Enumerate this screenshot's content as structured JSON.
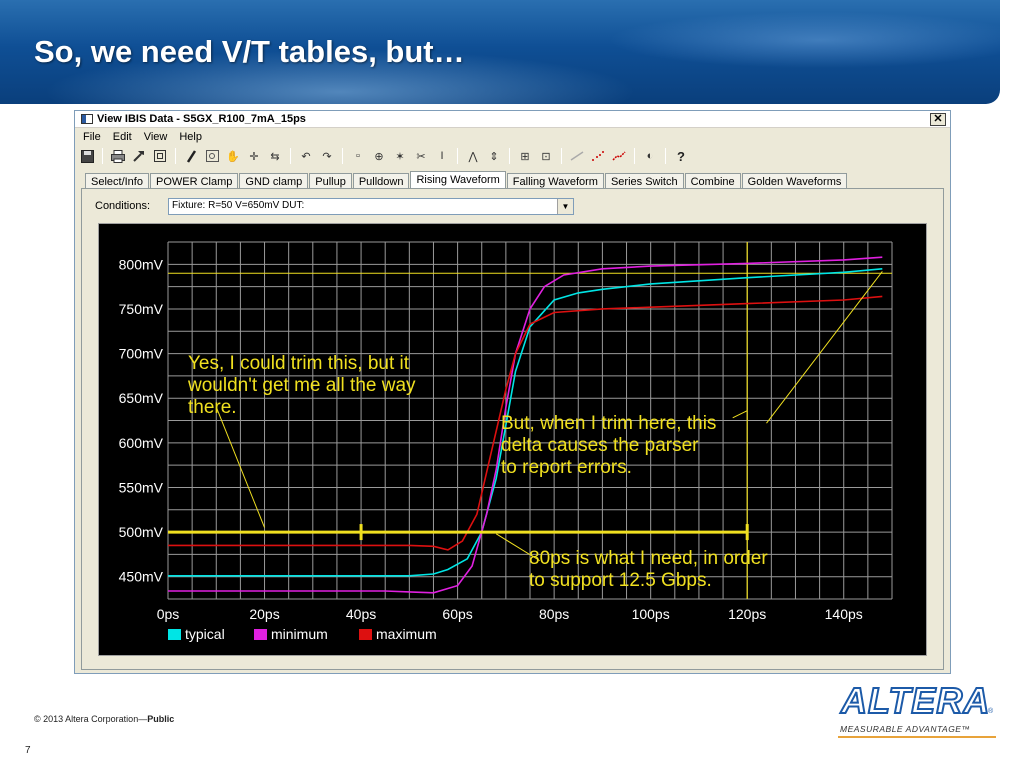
{
  "slide": {
    "title": "So, we need V/T tables, but…",
    "copyright_prefix": "© 2013 Altera Corporation—",
    "copyright_bold": "Public",
    "page_number": "7",
    "logo_text": "ALTERA",
    "logo_registered": "®",
    "logo_tagline": "MEASURABLE ADVANTAGE™"
  },
  "window": {
    "title": "View IBIS Data - S5GX_R100_7mA_15ps",
    "close_label": "✕",
    "menu": [
      "File",
      "Edit",
      "View",
      "Help"
    ],
    "toolbar_icons": [
      "save-icon",
      "print-icon",
      "hammer-icon",
      "frame-icon",
      "pencil-icon",
      "zoom-box-icon",
      "hand-icon",
      "crosshair-icon",
      "arrows-icon",
      "undo-icon",
      "redo-icon",
      "box-icon",
      "target-icon",
      "star-icon",
      "scissors-icon",
      "text-cursor-icon",
      "chevron-icon",
      "updown-icon",
      "fit-icon",
      "zoom-fit-icon",
      "line-icon",
      "dots-icon",
      "dash-icon",
      "disk-icon",
      "help-icon"
    ],
    "tabs": [
      {
        "label": "Select/Info",
        "active": false
      },
      {
        "label": "POWER Clamp",
        "active": false
      },
      {
        "label": "GND clamp",
        "active": false
      },
      {
        "label": "Pullup",
        "active": false
      },
      {
        "label": "Pulldown",
        "active": false
      },
      {
        "label": "Rising Waveform",
        "active": true
      },
      {
        "label": "Falling Waveform",
        "active": false
      },
      {
        "label": "Series Switch",
        "active": false
      },
      {
        "label": "Combine",
        "active": false
      },
      {
        "label": "Golden Waveforms",
        "active": false
      }
    ],
    "conditions_label": "Conditions:",
    "conditions_value": "Fixture: R=50 V=650mV  DUT:",
    "select_arrow": "▼"
  },
  "chart_data": {
    "type": "line",
    "x_unit": "ps",
    "y_unit": "mV",
    "xlim": [
      0,
      150
    ],
    "ylim": [
      425,
      825
    ],
    "x_ticks": [
      0,
      20,
      40,
      60,
      80,
      100,
      120,
      140
    ],
    "x_tick_labels": [
      "0ps",
      "20ps",
      "40ps",
      "60ps",
      "80ps",
      "100ps",
      "120ps",
      "140ps"
    ],
    "y_ticks": [
      450,
      500,
      550,
      600,
      650,
      700,
      750,
      800
    ],
    "y_tick_labels": [
      "450mV",
      "500mV",
      "550mV",
      "600mV",
      "650mV",
      "700mV",
      "750mV",
      "800mV"
    ],
    "grid": true,
    "legend_position": "bottom-left",
    "colors": {
      "typical": "#00e5e5",
      "minimum": "#e020e0",
      "maximum": "#dd1010",
      "annotation": "#f0e020"
    },
    "series": [
      {
        "name": "typical",
        "color": "#00e5e5",
        "x": [
          0,
          50,
          55,
          58,
          62,
          65,
          68,
          70,
          72,
          75,
          80,
          85,
          90,
          100,
          120,
          140,
          148
        ],
        "y": [
          451,
          451,
          453,
          458,
          470,
          500,
          560,
          620,
          680,
          730,
          760,
          768,
          772,
          778,
          785,
          791,
          795
        ]
      },
      {
        "name": "minimum",
        "color": "#e020e0",
        "x": [
          0,
          45,
          50,
          55,
          60,
          63,
          66,
          68,
          70,
          72,
          75,
          78,
          82,
          90,
          100,
          120,
          140,
          148
        ],
        "y": [
          434,
          434,
          433,
          432,
          440,
          462,
          520,
          570,
          640,
          700,
          750,
          775,
          788,
          795,
          798,
          801,
          805,
          808
        ]
      },
      {
        "name": "maximum",
        "color": "#dd1010",
        "x": [
          0,
          50,
          55,
          58,
          61,
          64,
          67,
          70,
          72,
          75,
          80,
          90,
          100,
          120,
          140,
          148
        ],
        "y": [
          485,
          485,
          484,
          480,
          490,
          520,
          590,
          660,
          700,
          733,
          746,
          750,
          752,
          756,
          760,
          764
        ]
      }
    ],
    "markers": {
      "vertical_line_x": 120,
      "horizontal_line_y": 500,
      "horizontal_span_x": [
        0,
        120
      ],
      "bracket_ticks_x": [
        40,
        120
      ],
      "reference_level_y": 790
    },
    "annotations": [
      {
        "id": "annot-trim",
        "lines": [
          "Yes, I could trim this, but it",
          "wouldn't get me all the way",
          "there."
        ],
        "pointer_from": [
          10,
          640
        ],
        "pointer_to": [
          20,
          505
        ]
      },
      {
        "id": "annot-trim-here",
        "lines": [
          "But, when I trim here, this",
          "delta causes the parser",
          "to report errors."
        ],
        "pointer_from": [
          124,
          622
        ],
        "pointer_to": [
          148,
          792
        ]
      },
      {
        "id": "annot-80ps",
        "lines": [
          "80ps is what I need, in order",
          "to support 12.5 Gbps."
        ],
        "pointer_from": [
          77,
          468
        ],
        "pointer_to": [
          68,
          498
        ]
      }
    ]
  }
}
